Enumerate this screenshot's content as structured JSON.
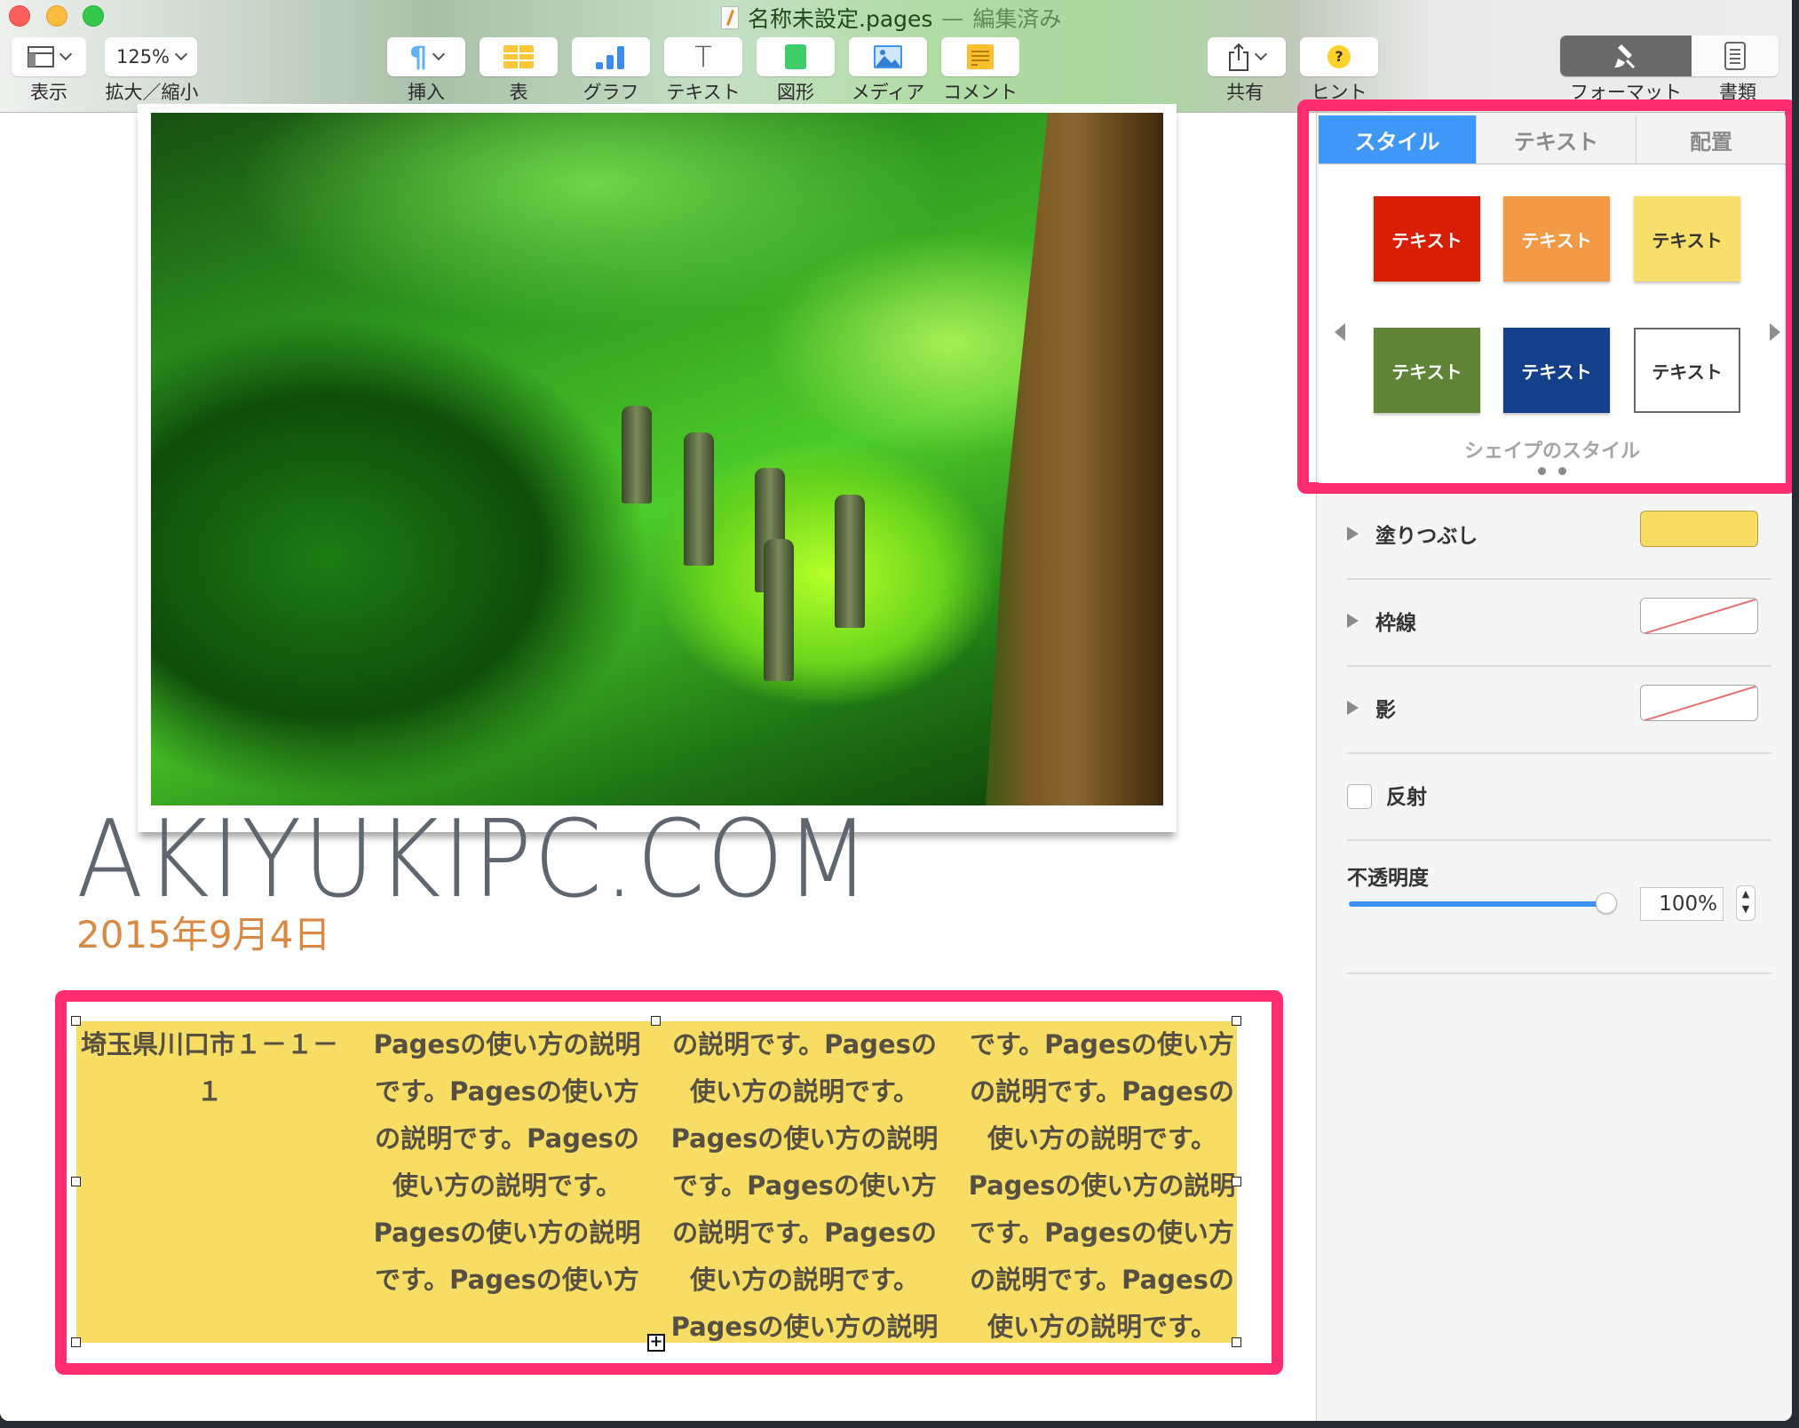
{
  "window": {
    "title": "名称未設定.pages",
    "separator": "—",
    "status": "編集済み"
  },
  "toolbar": {
    "view": {
      "label": "表示",
      "icon": "sidebar-layout-icon"
    },
    "zoom": {
      "label": "拡大／縮小",
      "value": "125%"
    },
    "insert": {
      "label": "挿入",
      "icon": "paragraph-icon"
    },
    "table": {
      "label": "表",
      "icon": "table-icon"
    },
    "chart": {
      "label": "グラフ",
      "icon": "bar-chart-icon"
    },
    "text": {
      "label": "テキスト",
      "icon": "text-icon",
      "glyph": "T"
    },
    "shape": {
      "label": "図形",
      "icon": "shape-icon"
    },
    "media": {
      "label": "メディア",
      "icon": "photo-icon"
    },
    "comment": {
      "label": "コメント",
      "icon": "comment-icon"
    },
    "share": {
      "label": "共有",
      "icon": "share-icon"
    },
    "tips": {
      "label": "ヒント",
      "icon": "help-icon",
      "glyph": "?"
    },
    "format": {
      "label": "フォーマット",
      "icon": "paintbrush-icon",
      "active": true
    },
    "document": {
      "label": "書類",
      "icon": "document-icon"
    }
  },
  "document": {
    "heading": "AKIYUKIPC.COM",
    "date": "2015年9月4日",
    "photo_alt": "Green forest garden with stone lanterns",
    "shape_columns": [
      [
        "埼玉県川口市１－１－",
        "１"
      ],
      [
        "Pagesの使い方の説明",
        "です。Pagesの使い方",
        "の説明です。Pagesの",
        "使い方の説明です。",
        "Pagesの使い方の説明",
        "です。Pagesの使い方"
      ],
      [
        "の説明です。Pagesの",
        "使い方の説明です。",
        "Pagesの使い方の説明",
        "です。Pagesの使い方",
        "の説明です。Pagesの",
        "使い方の説明です。",
        "Pagesの使い方の説明"
      ],
      [
        "です。Pagesの使い方",
        "の説明です。Pagesの",
        "使い方の説明です。",
        "Pagesの使い方の説明",
        "です。Pagesの使い方",
        "の説明です。Pagesの",
        "使い方の説明です。"
      ]
    ],
    "shape_fill": "#f7dd64"
  },
  "inspector": {
    "tabs": [
      {
        "label": "スタイル",
        "active": true
      },
      {
        "label": "テキスト",
        "active": false
      },
      {
        "label": "配置",
        "active": false
      }
    ],
    "styles": [
      {
        "label": "テキスト",
        "bg": "#d81f05",
        "fg": "#ffffff"
      },
      {
        "label": "テキスト",
        "bg": "#f29a46",
        "fg": "#ffffff"
      },
      {
        "label": "テキスト",
        "bg": "#f8de6a",
        "fg": "#333333"
      },
      {
        "label": "テキスト",
        "bg": "#5f8436",
        "fg": "#ffffff"
      },
      {
        "label": "テキスト",
        "bg": "#14408b",
        "fg": "#ffffff"
      },
      {
        "label": "テキスト",
        "bg": "#ffffff",
        "fg": "#333333"
      }
    ],
    "styles_caption": "シェイプのスタイル",
    "page_count": 2,
    "fill": {
      "label": "塗りつぶし",
      "color": "#f7dd64"
    },
    "border": {
      "label": "枠線",
      "value": "none"
    },
    "shadow": {
      "label": "影",
      "value": "none"
    },
    "reflection": {
      "label": "反射",
      "checked": false
    },
    "opacity": {
      "label": "不透明度",
      "value": "100%",
      "fraction": 1.0
    }
  },
  "annotations": {
    "highlight_color": "#ff2d6f"
  }
}
